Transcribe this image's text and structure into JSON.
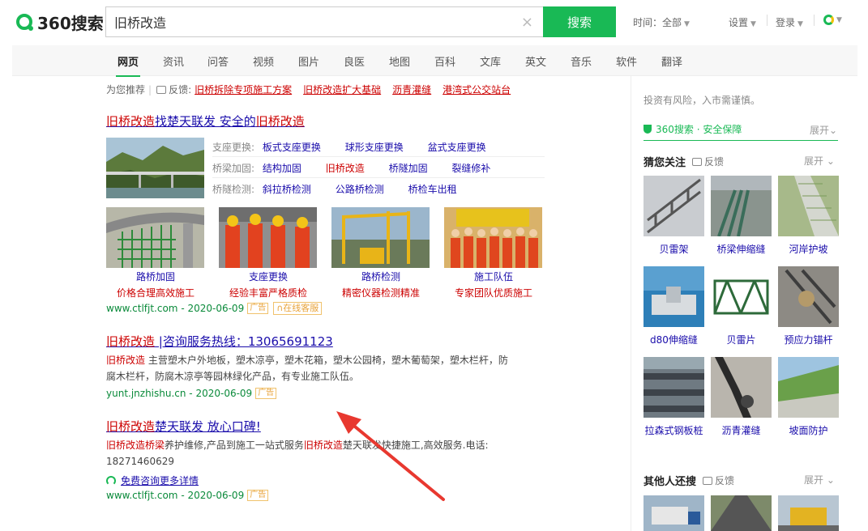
{
  "header": {
    "logo_text": "360搜索",
    "query": "旧桥改造",
    "clear_glyph": "×",
    "search_label": "搜索",
    "time_label": "时间：",
    "time_value": "全部",
    "settings_label": "设置",
    "login_label": "登录",
    "accent": "#19b955"
  },
  "nav": {
    "tabs": [
      "网页",
      "资讯",
      "问答",
      "视频",
      "图片",
      "良医",
      "地图",
      "百科",
      "文库",
      "英文",
      "音乐",
      "软件",
      "翻译"
    ]
  },
  "recommend": {
    "prefix": "为您推荐",
    "feedback": "反馈:",
    "links": [
      "旧桥拆除专项施工方案",
      "旧桥改造扩大基础",
      "沥青灌缝",
      "港湾式公交站台"
    ]
  },
  "result1": {
    "title_a": "旧桥改造",
    "title_b": "找楚天联发 安全的",
    "title_c": "旧桥改造",
    "rows": [
      {
        "key": "支座更换:",
        "vals": [
          "板式支座更换",
          "球形支座更换",
          "盆式支座更换"
        ]
      },
      {
        "key": "桥梁加固:",
        "vals": [
          "结构加固",
          "旧桥改造",
          "桥隧加固",
          "裂缝修补"
        ]
      },
      {
        "key": "桥隧检测:",
        "vals": [
          "斜拉桥检测",
          "公路桥检测",
          "桥检车出租"
        ]
      }
    ],
    "pics": [
      {
        "title": "路桥加固",
        "sub": "价格合理高效施工"
      },
      {
        "title": "支座更换",
        "sub": "经验丰富严格质检"
      },
      {
        "title": "路桥检测",
        "sub": "精密仪器检测精准"
      },
      {
        "title": "施工队伍",
        "sub": "专家团队优质施工"
      }
    ],
    "url": "www.ctlfjt.com - 2020-06-09",
    "ad": "广告",
    "service": "在线客服"
  },
  "result2": {
    "title_a": "旧桥改造",
    "title_b": " |咨询服务热线：13065691123",
    "desc_hl": "旧桥改造",
    "desc_1": " 主营塑木户外地板，塑木凉亭，塑木花箱，塑木公园椅，塑木葡萄架，塑木栏杆，防",
    "desc_2": "腐木栏杆，防腐木凉亭等园林绿化产品，有专业施工队伍。",
    "url": "yunt.jnzhishu.cn - 2020-06-09",
    "ad": "广告"
  },
  "result3": {
    "title_a": "旧桥改造",
    "title_b": "楚天联发 放心口碑!",
    "desc_hl1": "旧桥改造桥梁",
    "desc_1": "养护维修,产品到施工一站式服务",
    "desc_hl2": "旧桥改造",
    "desc_2": "楚天联发快捷施工,高效服务.电话:",
    "desc_3": "18271460629",
    "consult": "免费咨询更多详情",
    "url": "www.ctlfjt.com - 2020-06-09",
    "ad": "广告"
  },
  "right": {
    "risk": "投资有风险，入市需谨慎。",
    "safe": "360搜索 · 安全保障",
    "expand": "展开",
    "guess_title": "猜您关注",
    "feedback": "反馈",
    "tiles": [
      "贝雷架",
      "桥梁伸缩缝",
      "河岸护坡",
      "d80伸缩缝",
      "贝雷片",
      "预应力锚杆",
      "拉森式钢板桩",
      "沥青灌缝",
      "坡面防护"
    ],
    "others_title": "其他人还搜"
  },
  "colors": {
    "link": "#1a0dab",
    "highlight": "#cc0000",
    "url": "#0a8a3a",
    "arrow": "#e8382f"
  }
}
